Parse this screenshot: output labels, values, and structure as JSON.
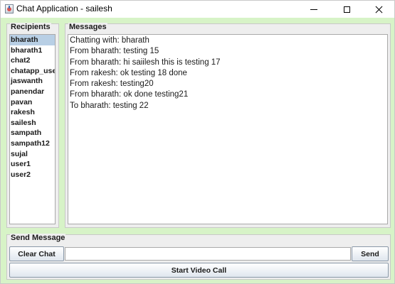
{
  "window": {
    "title": "Chat Application - sailesh"
  },
  "recipients": {
    "title": "Recipients",
    "selected": "bharath",
    "items": [
      "bharath",
      "bharath1",
      "chat2",
      "chatapp_user",
      "jaswanth",
      "panendar",
      "pavan",
      "rakesh",
      "sailesh",
      "sampath",
      "sampath12",
      "sujal",
      "user1",
      "user2"
    ]
  },
  "messages": {
    "title": "Messages",
    "lines": [
      "Chatting with: bharath",
      "From bharath: testing 15",
      "From bharath: hi saiilesh this is testing 17",
      "From rakesh: ok testing 18 done",
      "From rakesh: testing20",
      "From bharath: ok done testing21",
      "To bharath: testing 22"
    ]
  },
  "send": {
    "title": "Send Message",
    "clear_label": "Clear Chat",
    "send_label": "Send",
    "video_label": "Start Video Call",
    "input_value": ""
  },
  "icons": {
    "app": "java-coffee-cup-icon",
    "minimize": "minimize-icon",
    "maximize": "maximize-icon",
    "close": "close-icon"
  },
  "colors": {
    "background": "#d7f3c7",
    "panel": "#eeeeee",
    "selection": "#b8cfe5"
  }
}
